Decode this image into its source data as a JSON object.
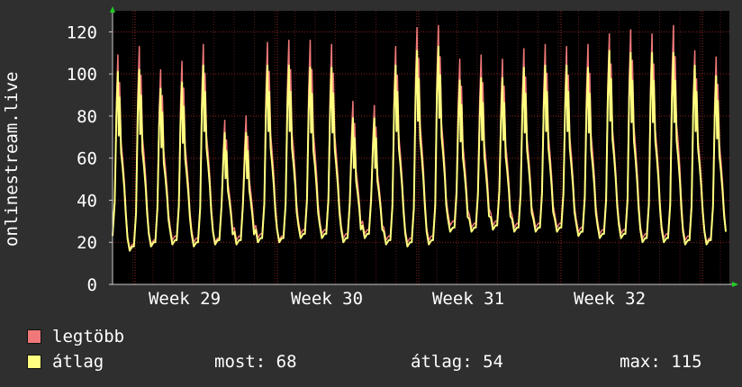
{
  "chart_data": {
    "type": "line",
    "ylabel": "onlinestream.live",
    "ylim": [
      0,
      130
    ],
    "yticks": [
      0,
      20,
      40,
      60,
      80,
      100,
      120
    ],
    "xticks": [
      "Week 29",
      "Week 30",
      "Week 31",
      "Week 32"
    ],
    "grid": true,
    "series": [
      {
        "name": "legtöbb",
        "color": "#f07878",
        "peaks": [
          109,
          113,
          102,
          106,
          114,
          78,
          80,
          115,
          116,
          116,
          114,
          87,
          85,
          113,
          122,
          123,
          107,
          109,
          107,
          112,
          114,
          113,
          114,
          119,
          121,
          119,
          123,
          111,
          108
        ],
        "troughs": [
          17,
          19,
          21,
          20,
          20,
          21,
          22,
          21,
          24,
          24,
          22,
          24,
          21,
          20,
          21,
          28,
          27,
          28,
          27,
          27,
          27,
          25,
          24,
          24,
          22,
          22,
          21,
          20
        ]
      },
      {
        "name": "átlag",
        "color": "#ffff80",
        "peaks": [
          101,
          102,
          93,
          96,
          104,
          72,
          72,
          104,
          104,
          103,
          103,
          79,
          79,
          104,
          111,
          113,
          97,
          98,
          98,
          103,
          104,
          104,
          103,
          111,
          110,
          110,
          110,
          104,
          99
        ],
        "troughs": [
          16,
          18,
          19,
          18,
          19,
          19,
          20,
          20,
          22,
          22,
          20,
          22,
          19,
          18,
          19,
          25,
          25,
          26,
          25,
          25,
          25,
          23,
          22,
          22,
          20,
          20,
          19,
          19
        ]
      }
    ]
  },
  "legend": [
    {
      "label": "legtöbb",
      "color": "#f07878"
    },
    {
      "label": "átlag",
      "color": "#ffff80"
    }
  ],
  "stats": {
    "now": "most: 68",
    "avg": "átlag: 54",
    "max": "max: 115"
  }
}
